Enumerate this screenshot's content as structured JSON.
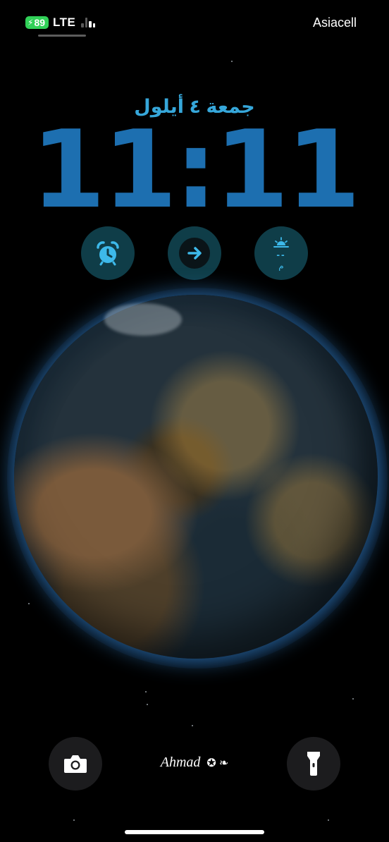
{
  "status_bar": {
    "battery_level": "89",
    "network_type": "LTE",
    "carrier": "Asiacell",
    "signal_bars_active": 2,
    "signal_bars_total": 4,
    "battery_color": "#31d158"
  },
  "lock_screen": {
    "date": "جمعة ٤ أيلول",
    "time": "11:11",
    "accent_color": "#36a7da",
    "time_color": "#1d6fb0"
  },
  "widgets": [
    {
      "icon": "alarm-clock-icon"
    },
    {
      "icon": "arrow-right-icon"
    },
    {
      "icon": "sunrise-icon",
      "value": "--",
      "unit": "م"
    }
  ],
  "bottom": {
    "camera_icon": "camera-icon",
    "flashlight_icon": "flashlight-icon",
    "signature": "Ahmad",
    "signature_symbols": "✪ ❧"
  },
  "wallpaper": {
    "subject": "earth-icon"
  }
}
